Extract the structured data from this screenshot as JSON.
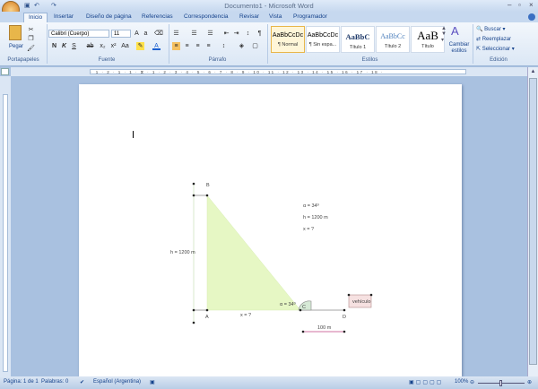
{
  "window": {
    "title": "Documento1 - Microsoft Word"
  },
  "tabs": [
    "Inicio",
    "Insertar",
    "Diseño de página",
    "Referencias",
    "Correspondencia",
    "Revisar",
    "Vista",
    "Programador"
  ],
  "ribbon": {
    "clipboard": {
      "paste": "Pegar",
      "label": "Portapapeles"
    },
    "font": {
      "name": "Calibri (Cuerpo)",
      "size": "11",
      "label": "Fuente",
      "bold": "N",
      "italic": "K",
      "underline": "S"
    },
    "paragraph": {
      "label": "Párrafo"
    },
    "styles": {
      "label": "Estilos",
      "items": [
        {
          "preview": "AaBbCcDc",
          "name": "¶ Normal"
        },
        {
          "preview": "AaBbCcDc",
          "name": "¶ Sin espa..."
        },
        {
          "preview": "AaBbC",
          "name": "Título 1"
        },
        {
          "preview": "AaBbCc",
          "name": "Título 2"
        },
        {
          "preview": "AaB",
          "name": "Título"
        }
      ],
      "change": "Cambiar estilos"
    },
    "editing": {
      "label": "Edición",
      "find": "Buscar",
      "replace": "Reemplazar",
      "select": "Seleccionar"
    }
  },
  "ruler": "· 1 · 2 · 1 · 1 · ⧖ · 1 · 2 · 3 · 4 · 5 · 6 · 7 · 8 · 9 · 10 · 11 · 12 · 13 · 14 · 15 · 16 · 17 · 18 ·",
  "figure": {
    "B": "B",
    "A": "A",
    "C": "C",
    "D": "D",
    "h_side": "h = 1200 m",
    "given1": "α = 34º",
    "given2": "h = 1200 m",
    "given3": "x = ?",
    "x_label": "x = ?",
    "angle_label": "α = 34º",
    "vehicle": "vehículo",
    "distance": "100 m"
  },
  "status": {
    "page": "Página: 1 de 1",
    "words": "Palabras: 0",
    "language": "Español (Argentina)",
    "zoom": "100%"
  },
  "colors": {
    "triangle": "#e6f7c4",
    "accent": "#15428b"
  }
}
